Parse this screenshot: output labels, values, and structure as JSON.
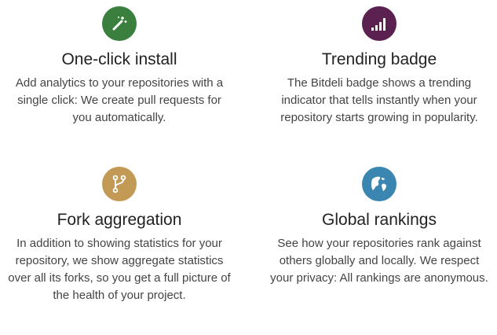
{
  "features": [
    {
      "icon": "magic-wand-icon",
      "color": "#3a7f3e",
      "title": "One-click install",
      "description": "Add analytics to your repositories with a single click: We create pull requests for you automatically."
    },
    {
      "icon": "signal-bars-icon",
      "color": "#5b2150",
      "title": "Trending badge",
      "description": "The Bitdeli badge shows a trending indicator that tells instantly when your repository starts growing in popularity."
    },
    {
      "icon": "fork-icon",
      "color": "#c29a55",
      "title": "Fork aggregation",
      "description": "In addition to showing statistics for your repository, we show aggregate statistics over all its forks, so you get a full picture of the health of your project."
    },
    {
      "icon": "globe-icon",
      "color": "#3b86b0",
      "title": "Global rankings",
      "description": "See how your repositories rank against others globally and locally. We respect your privacy: All rankings are anonymous."
    }
  ]
}
